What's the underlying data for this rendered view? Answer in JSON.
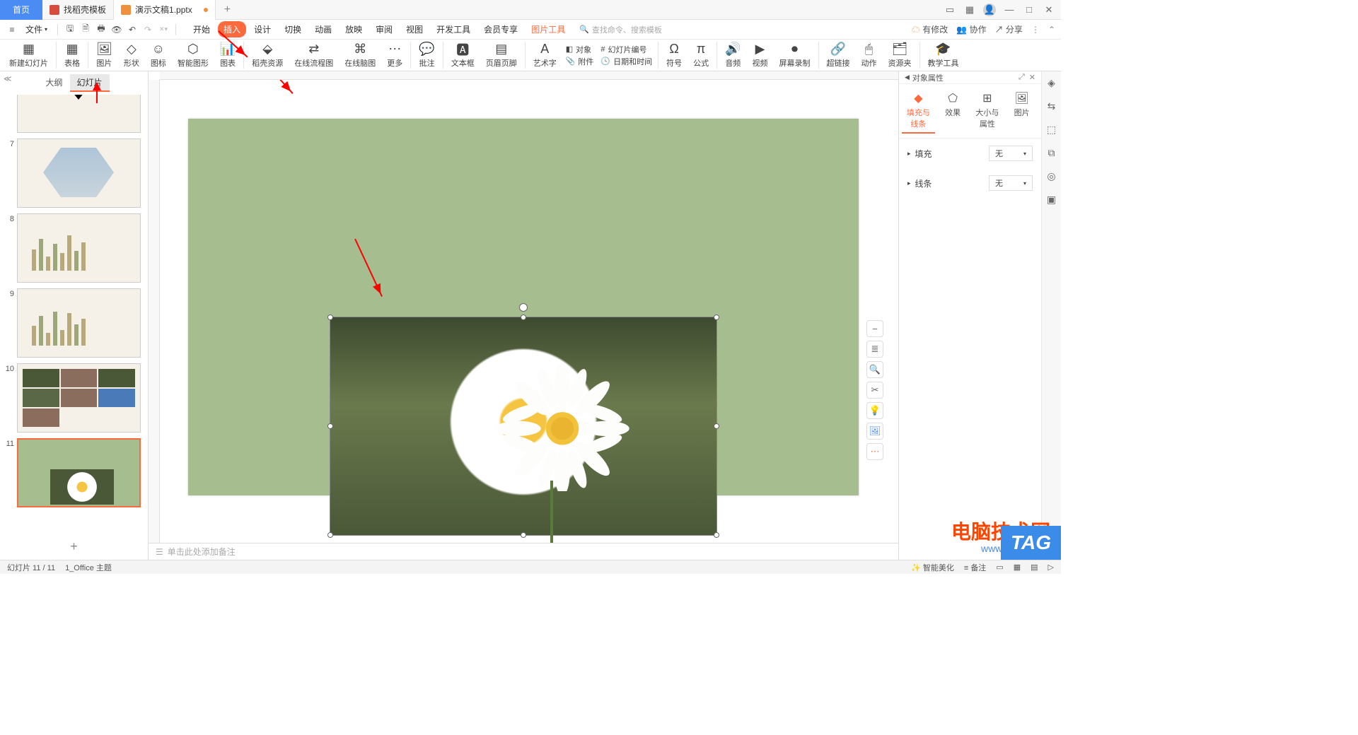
{
  "titlebar": {
    "home": "首页",
    "tab_template": "找稻壳模板",
    "tab_active": "演示文稿1.pptx",
    "add": "+"
  },
  "window": {
    "min": "—",
    "max": "□",
    "close": "✕"
  },
  "menubar": {
    "file": "文件",
    "tabs": [
      "开始",
      "插入",
      "设计",
      "切换",
      "动画",
      "放映",
      "审阅",
      "视图",
      "开发工具",
      "会员专享"
    ],
    "tool_tab": "图片工具",
    "search_placeholder": "查找命令、搜索模板",
    "right": {
      "unsaved": "有修改",
      "collab": "协作",
      "share": "分享"
    }
  },
  "ribbon": {
    "new_slide": "新建幻灯片",
    "table": "表格",
    "picture": "图片",
    "shape": "形状",
    "icon": "图标",
    "smart": "智能图形",
    "chart": "图表",
    "docer_res": "稻壳资源",
    "flowchart": "在线流程图",
    "mindmap": "在线脑图",
    "more": "更多",
    "comment": "批注",
    "textbox": "文本框",
    "header_footer": "页眉页脚",
    "wordart": "艺术字",
    "object": "对象",
    "slide_number": "幻灯片编号",
    "attach": "附件",
    "datetime": "日期和时间",
    "symbol": "符号",
    "formula": "公式",
    "audio": "音频",
    "video": "视频",
    "record": "屏幕录制",
    "hyperlink": "超链接",
    "action": "动作",
    "resource": "资源夹",
    "edutool": "教学工具"
  },
  "outline": {
    "tab_outline": "大纲",
    "tab_slide": "幻灯片"
  },
  "slides": {
    "nums": [
      "7",
      "8",
      "9",
      "10",
      "11"
    ]
  },
  "notes": {
    "placeholder": "单击此处添加备注"
  },
  "props": {
    "title": "对象属性",
    "tabs": {
      "fill": "填充与线条",
      "effect": "效果",
      "size": "大小与属性",
      "pic": "图片"
    },
    "fill_label": "填充",
    "line_label": "线条",
    "none": "无"
  },
  "statusbar": {
    "slide_pos": "幻灯片 11 / 11",
    "theme": "1_Office 主题",
    "beautify": "智能美化",
    "notes": "备注"
  },
  "watermark": {
    "main": "电脑技术网",
    "sub": "www.tagxp.com",
    "tag": "TAG"
  }
}
